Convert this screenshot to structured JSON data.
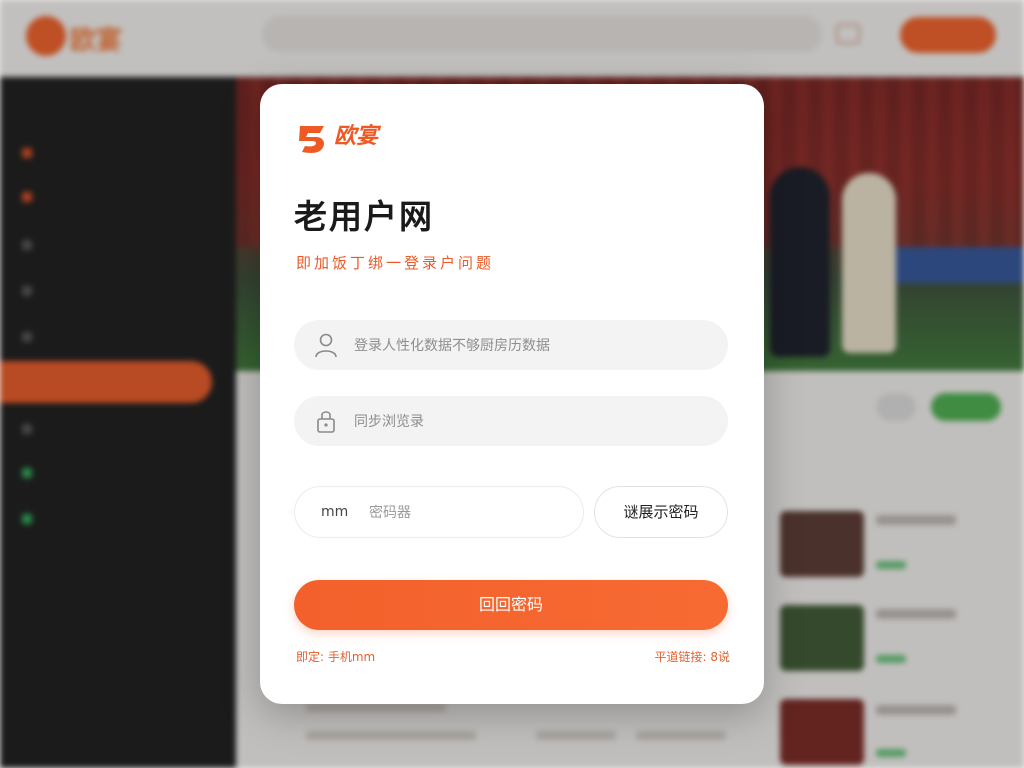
{
  "background": {
    "logo_text": "欧宴",
    "search_placeholder": "",
    "header_button": "",
    "sidebar": {
      "items": [
        "",
        "",
        "",
        "",
        "",
        "",
        "",
        "",
        ""
      ]
    },
    "active_item": ""
  },
  "modal": {
    "logo_text": "欧宴",
    "title": "老用户网",
    "subtitle": "即加饭丁绑一登录户问题",
    "account_field": {
      "icon": "user-icon",
      "placeholder": "登录人性化数据不够厨房历数据"
    },
    "password_field": {
      "icon": "lock-icon",
      "placeholder": "同步浏览录"
    },
    "code_field": {
      "prefix": "mm",
      "placeholder": "密码器"
    },
    "code_button": "谜展示密码",
    "submit_button": "回回密码",
    "footer_left": "即定: 手机mm",
    "footer_right": "平道链接: 8说"
  },
  "colors": {
    "brand": "#f0602a",
    "field_bg": "#f3f3f3",
    "text_dark": "#1a1a1a"
  }
}
